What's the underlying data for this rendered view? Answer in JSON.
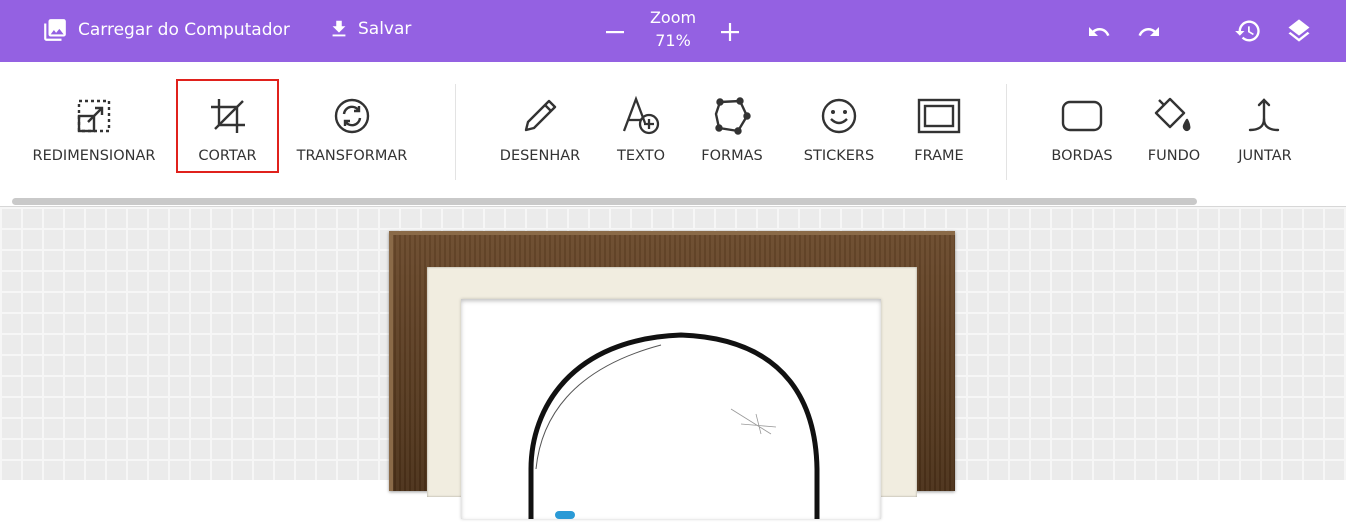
{
  "topbar": {
    "upload_label": "Carregar do Computador",
    "save_label": "Salvar",
    "zoom_label": "Zoom",
    "zoom_value": "71%",
    "accent_color": "#9461e2"
  },
  "toolbar": {
    "tools": [
      {
        "label": "REDIMENSIONAR",
        "icon": "resize-icon"
      },
      {
        "label": "CORTAR",
        "icon": "crop-icon",
        "selected": true
      },
      {
        "label": "TRANSFORMAR",
        "icon": "transform-icon"
      },
      {
        "label": "DESENHAR",
        "icon": "pencil-icon"
      },
      {
        "label": "TEXTO",
        "icon": "text-add-icon"
      },
      {
        "label": "FORMAS",
        "icon": "shapes-icon"
      },
      {
        "label": "STICKERS",
        "icon": "smiley-icon"
      },
      {
        "label": "FRAME",
        "icon": "frame-icon"
      },
      {
        "label": "BORDAS",
        "icon": "rounded-rect-icon"
      },
      {
        "label": "FUNDO",
        "icon": "paint-bucket-icon"
      },
      {
        "label": "JUNTAR",
        "icon": "merge-icon"
      }
    ],
    "selected_outline_color": "#e0211c"
  }
}
